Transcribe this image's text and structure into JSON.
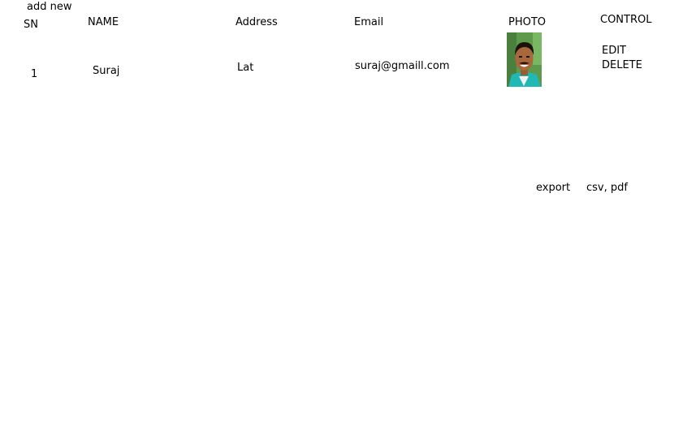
{
  "toolbar": {
    "add_new_label": "add new"
  },
  "table": {
    "headers": {
      "sn": "SN",
      "name": "NAME",
      "address": "Address",
      "email": "Email",
      "photo": "PHOTO",
      "control": "CONTROL"
    },
    "rows": [
      {
        "sn": "1",
        "name": "Suraj",
        "address": "Lat",
        "email": "suraj@gmaill.com",
        "photo_icon": "person-photo",
        "edit_label": "EDIT",
        "delete_label": "DELETE"
      }
    ]
  },
  "export": {
    "label": "export",
    "formats": "csv, pdf"
  }
}
